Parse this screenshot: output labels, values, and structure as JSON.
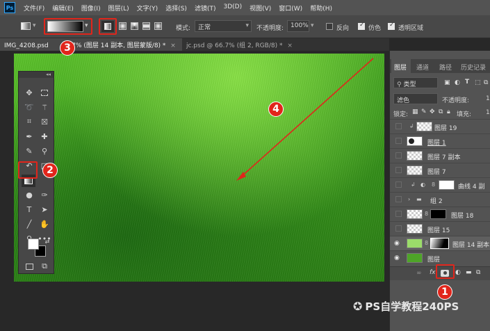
{
  "app": {
    "logo_text": "Ps"
  },
  "menu": [
    "文件(F)",
    "编辑(E)",
    "图像(I)",
    "图层(L)",
    "文字(Y)",
    "选择(S)",
    "滤镜(T)",
    "3D(D)",
    "视图(V)",
    "窗口(W)",
    "帮助(H)"
  ],
  "options": {
    "mode_label": "模式:",
    "mode_value": "正常",
    "opacity_label": "不透明度:",
    "opacity_value": "100%",
    "reverse_label": "反向",
    "dither_label": "仿色",
    "transparency_label": "透明区域",
    "reverse_checked": false,
    "dither_checked": true,
    "transparency_checked": true
  },
  "tabs": [
    {
      "label": "IMG_4208.psd",
      "suffix": "6.7% (图层 14 副本, 图层蒙版/8) *",
      "close": "×"
    },
    {
      "label": "jc.psd @ 66.7% (组 2, RGB/8) *",
      "close": "×"
    }
  ],
  "toolbox": {
    "header": "◂◂"
  },
  "panel": {
    "tabs": [
      "图层",
      "通道",
      "路径",
      "历史记录"
    ],
    "filter_value": "类型",
    "blend_value": "滤色",
    "opacity_label": "不透明度:",
    "opacity_value": "1",
    "lock_label": "锁定:",
    "fill_label": "填充:",
    "fill_value": "1",
    "layers": [
      {
        "name": "图层 19",
        "visible": false
      },
      {
        "name": "图层 1",
        "visible": false
      },
      {
        "name": "图层 7 副本",
        "visible": false
      },
      {
        "name": "图层 7",
        "visible": false
      },
      {
        "name": "曲线 4 副",
        "visible": false
      },
      {
        "name": "组 2",
        "visible": false
      },
      {
        "name": "图层 18",
        "visible": false
      },
      {
        "name": "图层 15",
        "visible": false
      },
      {
        "name": "图层 14 副本",
        "visible": true
      },
      {
        "name": "图层",
        "visible": true
      }
    ],
    "bottom_icons": [
      "link-icon",
      "fx-icon",
      "mask-icon",
      "adjustment-icon",
      "group-icon",
      "new-layer-icon"
    ]
  },
  "annotations": {
    "badge1": "1",
    "badge2": "2",
    "badge3": "3",
    "badge4": "4"
  },
  "watermark": {
    "text": "PS自学教程240PS"
  },
  "colors": {
    "annotation_red": "#e1251b",
    "canvas_green": "#3a9a1c"
  }
}
